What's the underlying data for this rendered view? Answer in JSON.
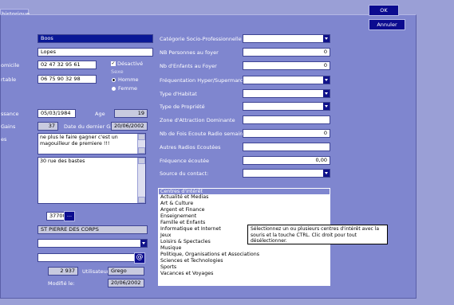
{
  "tab": "historique",
  "buttons": {
    "ok": "OK",
    "cancel": "Annuler",
    "browse": "...",
    "email": "@"
  },
  "left": {
    "firstname_value": "Boos",
    "lastname_value": "Lopes",
    "domicile_label": "omicile",
    "domicile_value": "02 47 32 95 61",
    "desactive_label": "Désactivé",
    "portable_label": "rtable",
    "portable_value": "06 75 90 32 98",
    "sexe_label": "Sexe",
    "homme_label": "Homme",
    "femme_label": "Femme",
    "naissance_label": "ssance",
    "naissance_value": "05/03/1984",
    "age_label": "Age",
    "age_value": "19",
    "gains_label": "Gains",
    "gains_value": "37",
    "dernier_gain_label": "Date du dernier Gain",
    "dernier_gain_value": "20/06/2002",
    "notes_label": "es",
    "notes_value": "ne plus le faire gagner c'est un magouilleur de premiere !!!",
    "address_value": "30 rue des bastes",
    "postal_value": "37700",
    "city_value": "ST PIERRE DES CORPS",
    "combo_value": "",
    "email_value": "",
    "count_value": "2 937",
    "utilisateur_label": "Utilisateur",
    "utilisateur_value": "Grego",
    "modifie_label": "Modifié le:",
    "modifie_value": "20/06/2002"
  },
  "right": {
    "csp_label": "Catégorie Socio-Professionnelle",
    "nb_pers_label": "NB Personnes au foyer",
    "nb_pers_value": "0",
    "nb_enf_label": "Nb d'Enfants au Foyer",
    "nb_enf_value": "0",
    "freq_hyper_label": "Fréquentation Hyper/Supermarchés",
    "type_habitat_label": "Type d'Habitat",
    "type_propriete_label": "Type de Propriété",
    "zone_label": "Zone d'Attraction Dominante",
    "radio_ecoute_label": "Nb de Fois Ecoute Radio semaine",
    "radio_ecoute_value": "0",
    "autres_radios_label": "Autres Radios Ecoutées",
    "frequence_label": "Fréquence écoutée",
    "frequence_value": "0,00",
    "source_label": "Source du contact:",
    "centres_title": "Centres d'intérêt",
    "centres": [
      "Actualité et Medias",
      "Art & Culture",
      "Argent et Finance",
      "Enseignement",
      "Famille et Enfants",
      "Informatique et Internet",
      "Jeux",
      "Loisirs & Spectacles",
      "Musique",
      "Politique, Organisations et Associations",
      "Sciences et Technologies",
      "Sports",
      "Vacances et Voyages"
    ],
    "tooltip": "Sélectionnez un ou plusieurs centres d'intérêt avec la souris et la touche CTRL. Clic droit pour tout désélectionner."
  }
}
